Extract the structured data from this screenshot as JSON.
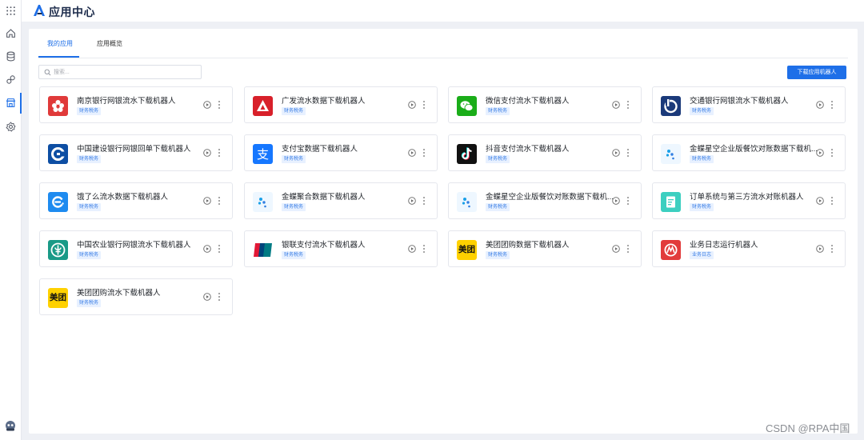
{
  "header": {
    "title": "应用中心"
  },
  "tabs": [
    {
      "label": "我的应用"
    },
    {
      "label": "应用概览"
    }
  ],
  "search": {
    "placeholder": "搜索..."
  },
  "toolbar": {
    "download_label": "下载应用机器人"
  },
  "colors": {
    "accent": "#1e6fe8",
    "tag_bg": "#e8f1ff",
    "tag_text": "#3a7ee6"
  },
  "apps": [
    {
      "name": "南京银行网银流水下载机器人",
      "tag": "财务税务",
      "icon": "nanjing-bank-icon"
    },
    {
      "name": "广发流水数据下载机器人",
      "tag": "财务税务",
      "icon": "cgb-bank-icon"
    },
    {
      "name": "微信支付流水下载机器人",
      "tag": "财务税务",
      "icon": "wechat-pay-icon"
    },
    {
      "name": "交通银行网银流水下载机器人",
      "tag": "财务税务",
      "icon": "bocom-bank-icon"
    },
    {
      "name": "中国建设银行网银回单下载机器人",
      "tag": "财务税务",
      "icon": "ccb-bank-icon"
    },
    {
      "name": "支付宝数据下载机器人",
      "tag": "财务税务",
      "icon": "alipay-icon"
    },
    {
      "name": "抖音支付流水下载机器人",
      "tag": "财务税务",
      "icon": "douyin-icon"
    },
    {
      "name": "金蝶星空企业版餐饮对账数据下载机...",
      "tag": "财务税务",
      "icon": "kingdee-icon"
    },
    {
      "name": "饿了么流水数据下载机器人",
      "tag": "财务税务",
      "icon": "eleme-icon"
    },
    {
      "name": "金蝶聚合数据下载机器人",
      "tag": "财务税务",
      "icon": "kingdee-icon"
    },
    {
      "name": "金蝶星空企业版餐饮对账数据下载机...",
      "tag": "财务税务",
      "icon": "kingdee-icon"
    },
    {
      "name": "订单系统与第三方流水对账机器人",
      "tag": "财务税务",
      "icon": "order-system-icon"
    },
    {
      "name": "中国农业银行网银流水下载机器人",
      "tag": "财务税务",
      "icon": "abc-bank-icon"
    },
    {
      "name": "银联支付流水下载机器人",
      "tag": "财务税务",
      "icon": "unionpay-icon"
    },
    {
      "name": "美团团购数据下载机器人",
      "tag": "财务税务",
      "icon": "meituan-icon",
      "icon_text": "美团"
    },
    {
      "name": "业务日志运行机器人",
      "tag": "业务日志",
      "icon": "business-log-icon"
    },
    {
      "name": "美团团购流水下载机器人",
      "tag": "财务税务",
      "icon": "meituan-icon",
      "icon_text": "美团"
    }
  ],
  "watermark": "CSDN @RPA中国"
}
